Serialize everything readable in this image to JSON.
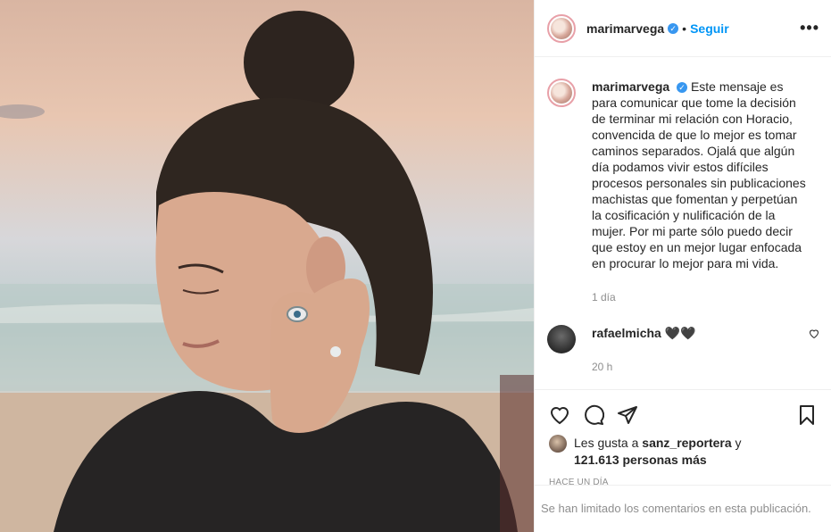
{
  "post": {
    "username": "marimarvega",
    "verified_mark": "✓",
    "dot": "•",
    "follow_label": "Seguir",
    "more_label": "•••",
    "caption_username": "marimarvega",
    "caption_text": "Este mensaje es para comunicar que tome la decisión de terminar mi relación con Horacio, convencida de que lo mejor es tomar caminos separados. Ojalá que algún día podamos vivir estos difíciles procesos personales sin publicaciones machistas que fomentan y perpetúan la cosificación y nulificación de la mujer. Por mi parte sólo puedo decir que estoy en un mejor lugar enfocada en procurar lo mejor para mi vida.",
    "caption_time": "1 día",
    "photo_description_icon": "photo-woman-beach"
  },
  "comments": [
    {
      "username": "rafaelmicha",
      "text": "🖤🖤",
      "time": "20 h"
    }
  ],
  "actions": {
    "like_icon": "heart-icon",
    "comment_icon": "comment-icon",
    "share_icon": "send-icon",
    "save_icon": "bookmark-icon"
  },
  "likes": {
    "prefix": "Les gusta a ",
    "user": "sanz_reportera",
    "conj": " y",
    "count": "121.613 personas más"
  },
  "ago": "Hace un día",
  "limited_comments": "Se han limitado los comentarios en esta publicación.",
  "colors": {
    "accent": "#0095f6",
    "verified": "#3897f0",
    "muted": "#8e8e8e"
  }
}
